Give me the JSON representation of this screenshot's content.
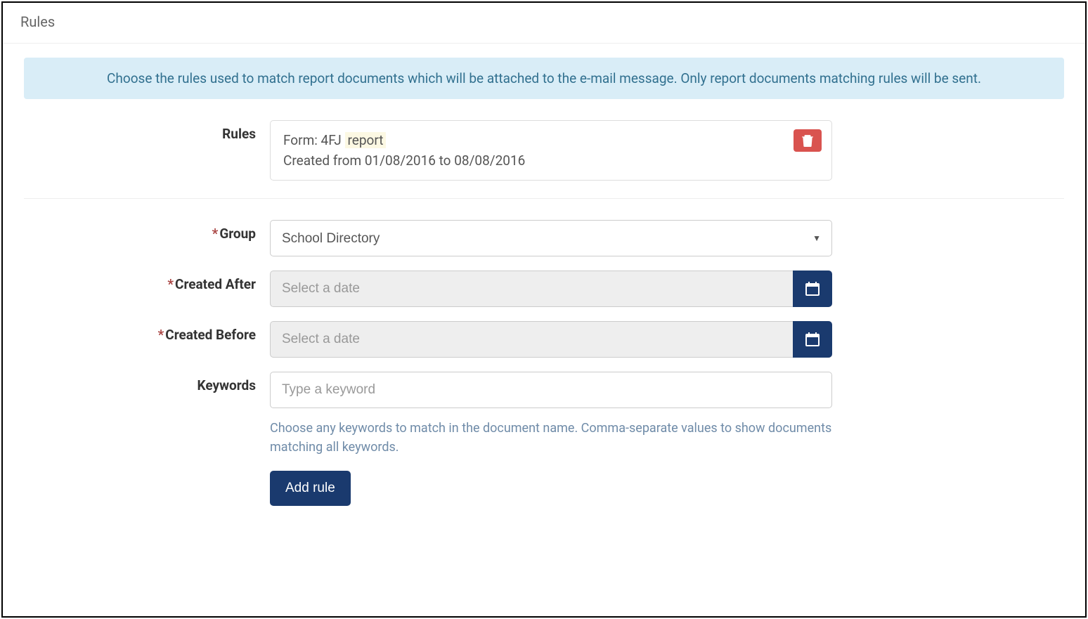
{
  "header": {
    "title": "Rules"
  },
  "banner": {
    "text": "Choose the rules used to match report documents which will be attached to the e-mail message. Only report documents matching rules will be sent."
  },
  "rules": {
    "label": "Rules",
    "item": {
      "form_prefix": "Form: 4FJ ",
      "form_highlight": "report",
      "created_line": "Created from 01/08/2016 to 08/08/2016"
    }
  },
  "group": {
    "label": "Group",
    "required": "*",
    "selected": "School Directory"
  },
  "created_after": {
    "label": "Created After",
    "required": "*",
    "placeholder": "Select a date",
    "value": ""
  },
  "created_before": {
    "label": "Created Before",
    "required": "*",
    "placeholder": "Select a date",
    "value": ""
  },
  "keywords": {
    "label": "Keywords",
    "placeholder": "Type a keyword",
    "value": "",
    "help": "Choose any keywords to match in the document name. Comma-separate values to show documents matching all keywords."
  },
  "actions": {
    "add_rule": "Add rule"
  }
}
